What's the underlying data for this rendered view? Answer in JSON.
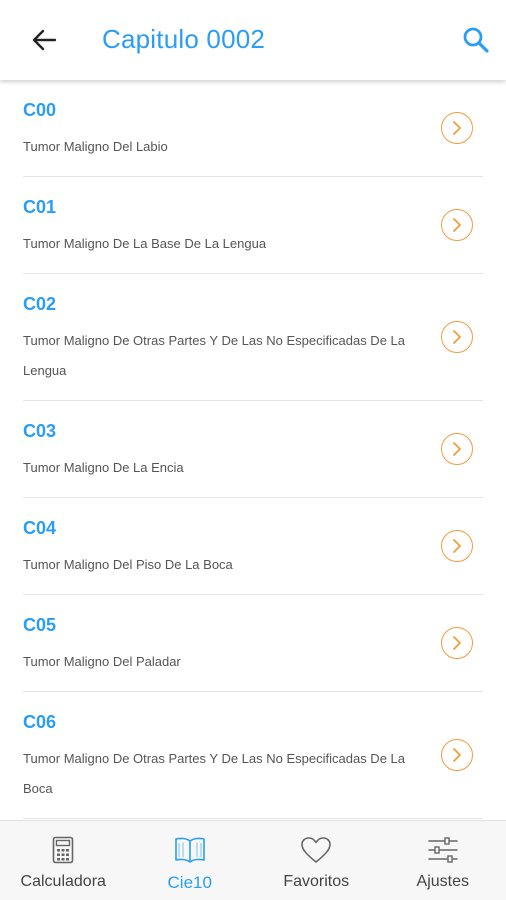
{
  "header": {
    "title": "Capitulo 0002",
    "back_icon": "arrow-left-icon",
    "search_icon": "search-icon"
  },
  "colors": {
    "accent": "#2a9df4",
    "chevron": "#f39c3c",
    "text_secondary": "#555555"
  },
  "items": [
    {
      "code": "C00",
      "description": "Tumor Maligno Del Labio"
    },
    {
      "code": "C01",
      "description": "Tumor Maligno De La Base De La Lengua"
    },
    {
      "code": "C02",
      "description": "Tumor Maligno De Otras Partes Y De Las No Especificadas De La Lengua"
    },
    {
      "code": "C03",
      "description": "Tumor Maligno De La Encia"
    },
    {
      "code": "C04",
      "description": "Tumor Maligno Del Piso De La Boca"
    },
    {
      "code": "C05",
      "description": "Tumor Maligno Del Paladar"
    },
    {
      "code": "C06",
      "description": "Tumor Maligno De Otras Partes Y De Las No Especificadas De La Boca"
    }
  ],
  "bottom_nav": [
    {
      "label": "Calculadora",
      "icon": "calculator-icon",
      "active": false
    },
    {
      "label": "Cie10",
      "icon": "book-icon",
      "active": true
    },
    {
      "label": "Favoritos",
      "icon": "heart-icon",
      "active": false
    },
    {
      "label": "Ajustes",
      "icon": "sliders-icon",
      "active": false
    }
  ]
}
